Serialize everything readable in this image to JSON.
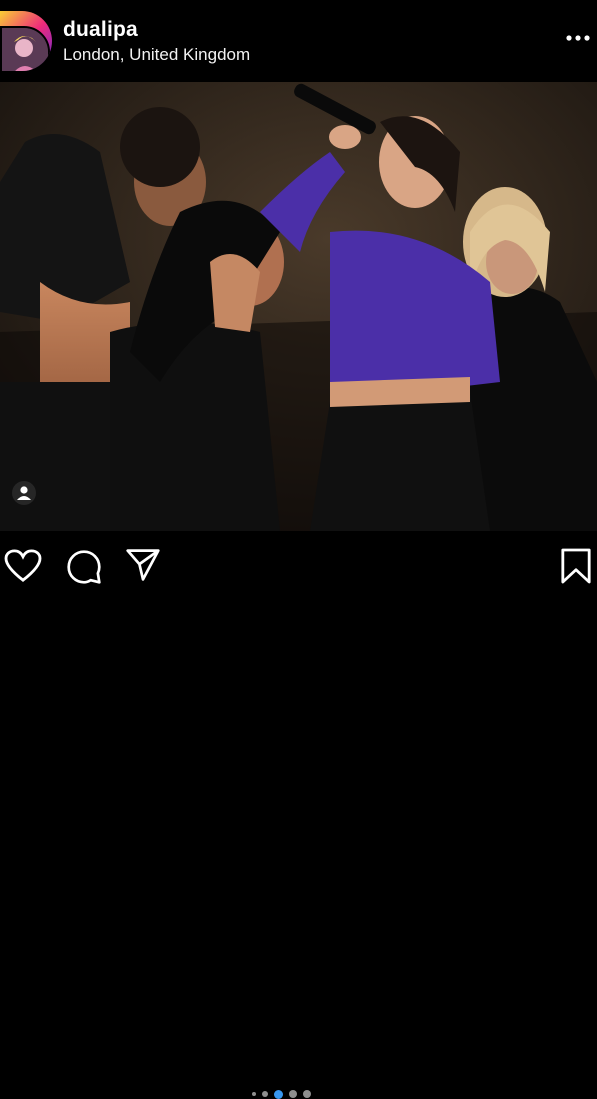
{
  "post": {
    "username": "dualipa",
    "location": "London, United Kingdom"
  },
  "carousel": {
    "total": 5,
    "active_index": 2
  },
  "icons": {
    "more": "more-options-icon",
    "like": "heart-icon",
    "comment": "comment-bubble-icon",
    "share": "paper-plane-icon",
    "save": "bookmark-icon",
    "tag": "user-tag-icon"
  },
  "colors": {
    "background": "#000000",
    "text": "#ffffff",
    "active_dot": "#3897f0",
    "inactive_dot": "#8e8e8e"
  }
}
